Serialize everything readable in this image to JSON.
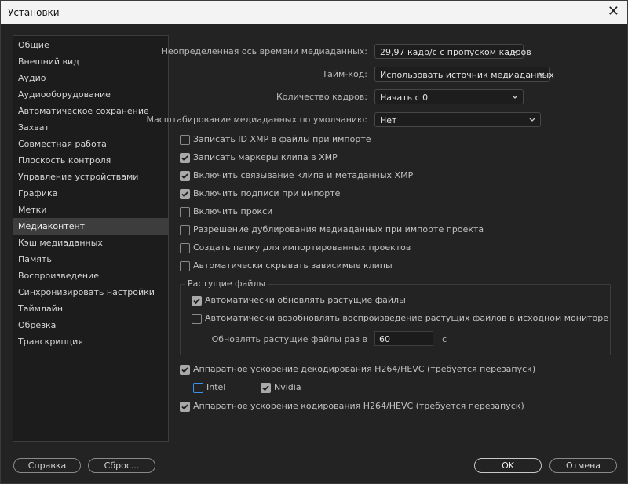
{
  "window": {
    "title": "Установки"
  },
  "sidebar": {
    "items": [
      {
        "label": "Общие"
      },
      {
        "label": "Внешний вид"
      },
      {
        "label": "Аудио"
      },
      {
        "label": "Аудиооборудование"
      },
      {
        "label": "Автоматическое сохранение"
      },
      {
        "label": "Захват"
      },
      {
        "label": "Совместная работа"
      },
      {
        "label": "Плоскость контроля"
      },
      {
        "label": "Управление устройствами"
      },
      {
        "label": "Графика"
      },
      {
        "label": "Метки"
      },
      {
        "label": "Медиаконтент"
      },
      {
        "label": "Кэш медиаданных"
      },
      {
        "label": "Память"
      },
      {
        "label": "Воспроизведение"
      },
      {
        "label": "Синхронизировать настройки"
      },
      {
        "label": "Таймлайн"
      },
      {
        "label": "Обрезка"
      },
      {
        "label": "Транскрипция"
      }
    ],
    "selected": "Медиаконтент"
  },
  "settings": {
    "timebase": {
      "label": "Неопределенная ось времени медиаданных:",
      "value": "29,97 кадр/с с пропуском кадров"
    },
    "timecode": {
      "label": "Тайм-код:",
      "value": "Использовать источник медиаданных"
    },
    "frame_count": {
      "label": "Количество кадров:",
      "value": "Начать с 0"
    },
    "default_scale": {
      "label": "Масштабирование медиаданных по умолчанию:",
      "value": "Нет"
    }
  },
  "checkboxes": [
    {
      "label": "Записать ID XMP в файлы при импорте",
      "checked": false
    },
    {
      "label": "Записать маркеры клипа в XMP",
      "checked": true
    },
    {
      "label": "Включить связывание клипа и метаданных XMP",
      "checked": true
    },
    {
      "label": "Включить подписи при импорте",
      "checked": true
    },
    {
      "label": "Включить прокси",
      "checked": false
    },
    {
      "label": "Разрешение дублирования медиаданных при импорте проекта",
      "checked": false
    },
    {
      "label": "Создать папку для импортированных проектов",
      "checked": false
    },
    {
      "label": "Автоматически скрывать зависимые клипы",
      "checked": false
    }
  ],
  "growing_files": {
    "title": "Растущие файлы",
    "auto_refresh": {
      "label": "Автоматически обновлять растущие файлы",
      "checked": true
    },
    "auto_resume": {
      "label": "Автоматически возобновлять воспроизведение растущих файлов в исходном мониторе",
      "checked": false
    },
    "refresh_label": "Обновлять растущие файлы раз в",
    "refresh_value": "60",
    "refresh_unit": "с"
  },
  "hw_decode": {
    "label": "Аппаратное ускорение декодирования H264/HEVC (требуется перезапуск)",
    "checked": true
  },
  "intel": {
    "label": "Intel",
    "checked": false
  },
  "nvidia": {
    "label": "Nvidia",
    "checked": true
  },
  "hw_encode": {
    "label": "Аппаратное ускорение кодирования H264/HEVC (требуется перезапуск)",
    "checked": true
  },
  "footer": {
    "help": "Справка",
    "reset": "Сброс...",
    "ok": "OK",
    "cancel": "Отмена"
  }
}
